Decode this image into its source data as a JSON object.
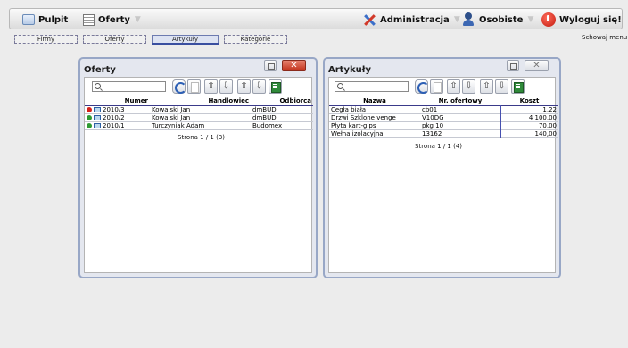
{
  "menubar": {
    "pulpit_label": "Pulpit",
    "oferty_label": "Oferty",
    "administracja_label": "Administracja",
    "osobiste_label": "Osobiste",
    "logout_label": "Wyloguj się!",
    "arrow": "▼"
  },
  "tabs": [
    "Firmy",
    "Oferty",
    "Artykuły",
    "Kategorie"
  ],
  "hide_menu_label": "Schowaj menu",
  "oferty_window": {
    "title": "Oferty",
    "close_symbol": "✕",
    "toolbar": [
      "⇧",
      "⇩",
      "⇧",
      "⇩"
    ],
    "columns": [
      "Numer",
      "Handlowiec",
      "Odbiorca"
    ],
    "rows": [
      {
        "status": "red",
        "numer": "2010/3",
        "handlowiec": "Kowalski Jan",
        "odbiorca": "dmBUD"
      },
      {
        "status": "green",
        "numer": "2010/2",
        "handlowiec": "Kowalski Jan",
        "odbiorca": "dmBUD"
      },
      {
        "status": "green",
        "numer": "2010/1",
        "handlowiec": "Turczyniak Adam",
        "odbiorca": "Budomex"
      }
    ],
    "pager": "Strona 1 / 1 (3)"
  },
  "artykuly_window": {
    "title": "Artykuły",
    "close_symbol": "✕",
    "toolbar": [
      "⇧",
      "⇩",
      "⇧",
      "⇩"
    ],
    "columns": [
      "Nazwa",
      "Nr. ofertowy",
      "Koszt"
    ],
    "rows": [
      {
        "nazwa": "Cegła biała",
        "nr": "cb01",
        "koszt": "1,22"
      },
      {
        "nazwa": "Drzwi Szklone venge",
        "nr": "V10DG",
        "koszt": "4 100,00"
      },
      {
        "nazwa": "Płyta kart-gips",
        "nr": "pkg 10",
        "koszt": "70,00"
      },
      {
        "nazwa": "Wełna izolacyjna",
        "nr": "13162",
        "koszt": "140,00"
      }
    ],
    "pager": "Strona 1 / 1 (4)"
  },
  "colors": {
    "status_red": "#d4221a",
    "status_green": "#2e9a33",
    "window_border": "#98a7c6",
    "accent": "#3a4fa0"
  }
}
